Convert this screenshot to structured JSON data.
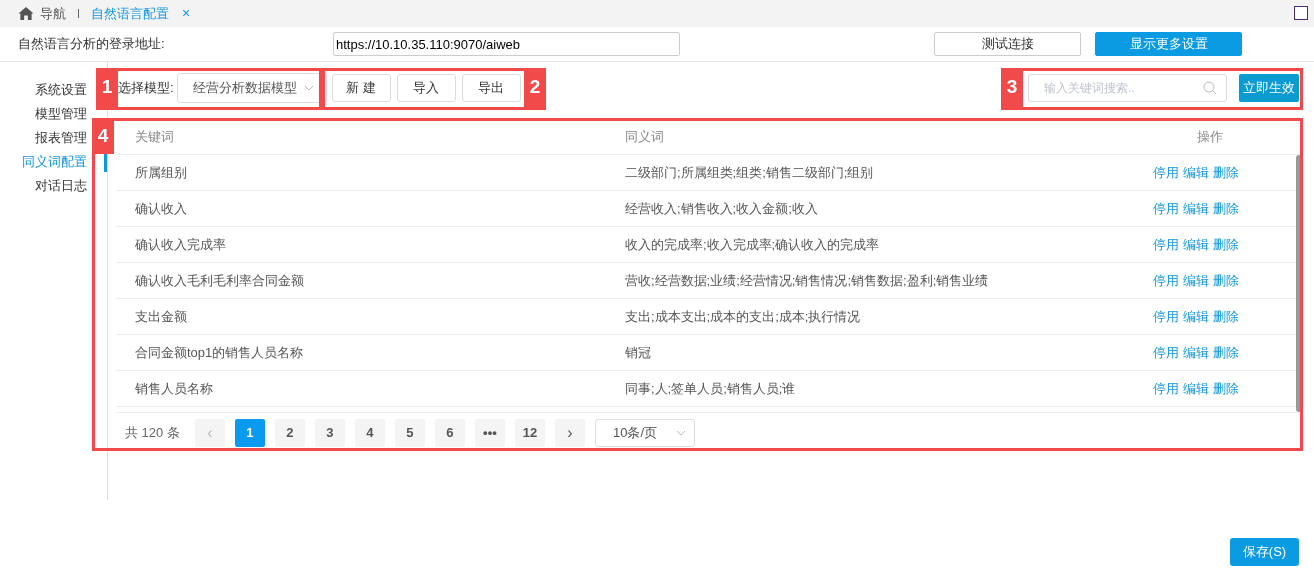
{
  "tabs": [
    {
      "label": "导航",
      "selected": false
    },
    {
      "label": "自然语言配置",
      "selected": true,
      "close": "×"
    }
  ],
  "address": {
    "label": "自然语言分析的登录地址:",
    "value": "https://10.10.35.110:9070/aiweb"
  },
  "header_buttons": [
    {
      "label": "测试连接",
      "kind": "outline"
    },
    {
      "label": "显示更多设置",
      "kind": "primary"
    }
  ],
  "sidebar": {
    "items": [
      {
        "label": "系统设置",
        "selected": false
      },
      {
        "label": "模型管理",
        "selected": false
      },
      {
        "label": "报表管理",
        "selected": false
      },
      {
        "label": "同义词配置",
        "selected": true
      },
      {
        "label": "对话日志",
        "selected": false
      }
    ]
  },
  "toolbar": {
    "model_label": "选择模型:",
    "model_value": "经营分析数据模型",
    "buttons": [
      "新 建",
      "导入",
      "导出"
    ],
    "search_placeholder": "输入关键词搜索..",
    "apply": "立即生效"
  },
  "table": {
    "columns": [
      "关键词",
      "同义词",
      "操作"
    ],
    "rows": [
      {
        "keyword": "所属组别",
        "synonyms": "二级部门;所属组类;组类;销售二级部门;组别",
        "actions": [
          "停用",
          "编辑",
          "删除"
        ]
      },
      {
        "keyword": "确认收入",
        "synonyms": "经营收入;销售收入;收入金额;收入",
        "actions": [
          "停用",
          "编辑",
          "删除"
        ]
      },
      {
        "keyword": "确认收入完成率",
        "synonyms": "收入的完成率;收入完成率;确认收入的完成率",
        "actions": [
          "停用",
          "编辑",
          "删除"
        ]
      },
      {
        "keyword": "确认收入毛利毛利率合同金额",
        "synonyms": "营收;经营数据;业绩;经营情况;销售情况;销售数据;盈利;销售业绩",
        "actions": [
          "停用",
          "编辑",
          "删除"
        ]
      },
      {
        "keyword": "支出金额",
        "synonyms": "支出;成本支出;成本的支出;成本;执行情况",
        "actions": [
          "停用",
          "编辑",
          "删除"
        ]
      },
      {
        "keyword": "合同金额top1的销售人员名称",
        "synonyms": "销冠",
        "actions": [
          "停用",
          "编辑",
          "删除"
        ]
      },
      {
        "keyword": "销售人员名称",
        "synonyms": "同事;人;签单人员;销售人员;谁",
        "actions": [
          "停用",
          "编辑",
          "删除"
        ]
      }
    ]
  },
  "pagination": {
    "total": "共 120 条",
    "prev": "‹",
    "next": "›",
    "pages": [
      {
        "label": "1",
        "selected": true
      },
      {
        "label": "2",
        "selected": false
      },
      {
        "label": "3",
        "selected": false
      },
      {
        "label": "4",
        "selected": false
      },
      {
        "label": "5",
        "selected": false
      },
      {
        "label": "6",
        "selected": false
      },
      {
        "label": "•••",
        "selected": false
      },
      {
        "label": "12",
        "selected": false
      }
    ],
    "page_size": "10条/页"
  },
  "callouts": [
    {
      "label": "1"
    },
    {
      "label": "2"
    },
    {
      "label": "3"
    },
    {
      "label": "4"
    }
  ],
  "save": "保存(S)"
}
